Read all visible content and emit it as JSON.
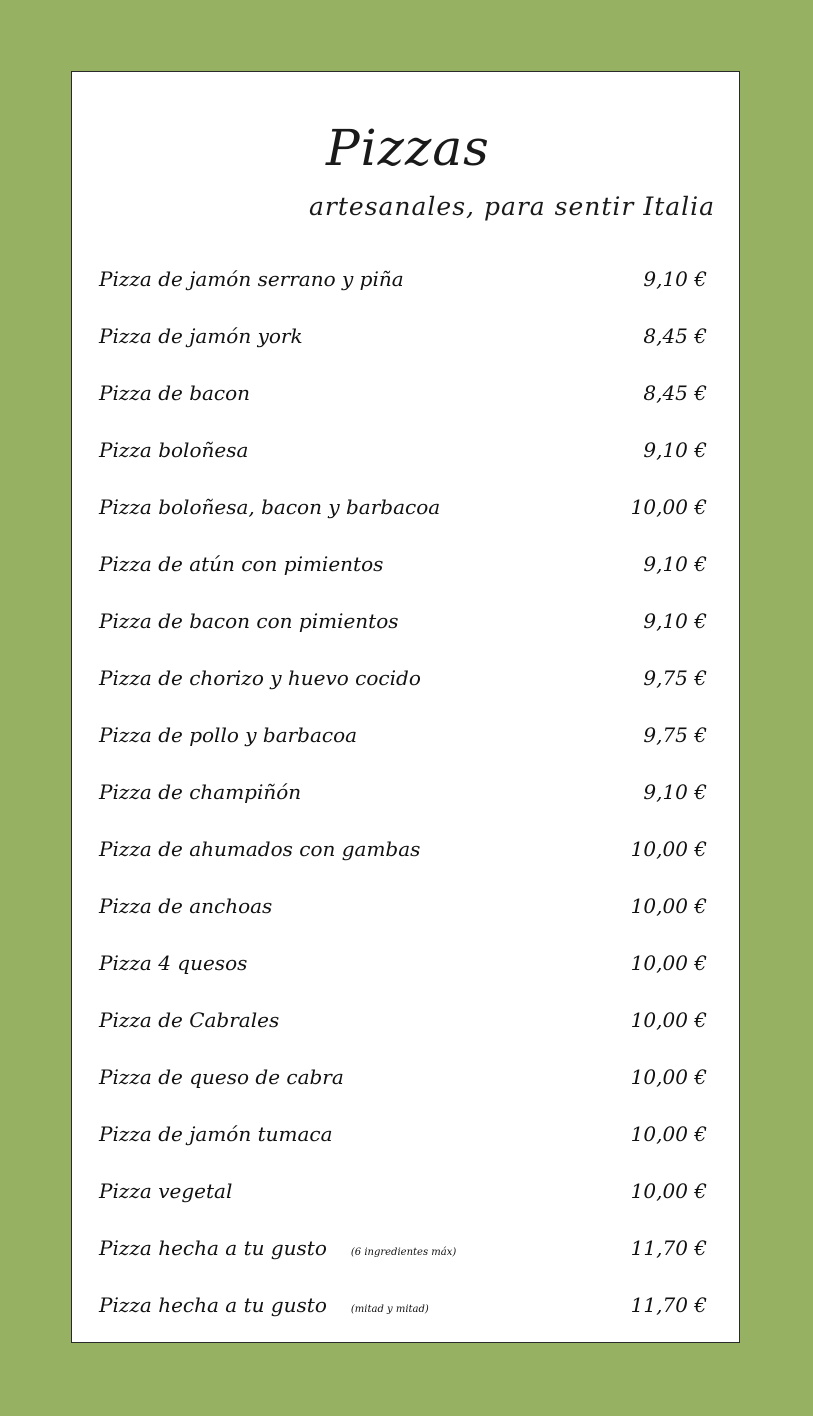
{
  "menu": {
    "title": "Pizzas",
    "subtitle": "artesanales, para sentir Italia",
    "items": [
      {
        "name": "Pizza de jamón serrano y piña",
        "note": "",
        "price": "9,10 €"
      },
      {
        "name": "Pizza de jamón york",
        "note": "",
        "price": "8,45 €"
      },
      {
        "name": "Pizza de bacon",
        "note": "",
        "price": "8,45 €"
      },
      {
        "name": "Pizza boloñesa",
        "note": "",
        "price": "9,10 €"
      },
      {
        "name": "Pizza boloñesa, bacon y barbacoa",
        "note": "",
        "price": "10,00 €"
      },
      {
        "name": "Pizza de atún con pimientos",
        "note": "",
        "price": "9,10 €"
      },
      {
        "name": "Pizza de bacon con pimientos",
        "note": "",
        "price": "9,10 €"
      },
      {
        "name": "Pizza de chorizo y huevo cocido",
        "note": "",
        "price": "9,75 €"
      },
      {
        "name": "Pizza de pollo y barbacoa",
        "note": "",
        "price": "9,75 €"
      },
      {
        "name": "Pizza de champiñón",
        "note": "",
        "price": "9,10 €"
      },
      {
        "name": "Pizza de ahumados con gambas",
        "note": "",
        "price": "10,00 €"
      },
      {
        "name": "Pizza de anchoas",
        "note": "",
        "price": "10,00 €"
      },
      {
        "name": "Pizza 4 quesos",
        "note": "",
        "price": "10,00 €"
      },
      {
        "name": "Pizza de Cabrales",
        "note": "",
        "price": "10,00 €"
      },
      {
        "name": "Pizza de queso de cabra",
        "note": "",
        "price": "10,00 €"
      },
      {
        "name": "Pizza de jamón tumaca",
        "note": "",
        "price": "10,00 €"
      },
      {
        "name": "Pizza vegetal",
        "note": "",
        "price": "10,00 €"
      },
      {
        "name": "Pizza hecha a tu gusto",
        "note": "(6 ingredientes máx)",
        "price": "11,70 €"
      },
      {
        "name": "Pizza hecha a tu gusto",
        "note": "(mitad y mitad)",
        "price": "11,70 €"
      }
    ]
  },
  "colors": {
    "background": "#97b163",
    "card": "#ffffff",
    "text": "#111111"
  }
}
